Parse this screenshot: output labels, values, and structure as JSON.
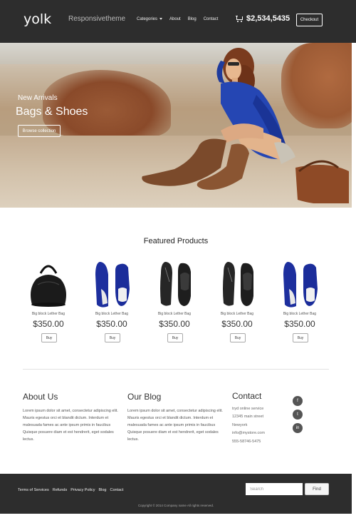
{
  "header": {
    "logo": "yolk",
    "tagline": "Responsivetheme",
    "nav": [
      "Categories",
      "About",
      "Blog",
      "Contact"
    ],
    "cart_total": "$2,534,5435",
    "checkout_label": "Checkout"
  },
  "hero": {
    "subtitle": "New Arrivals",
    "title": "Bags & Shoes",
    "button_label": "Browse collection"
  },
  "featured": {
    "title": "Featured Products",
    "products": [
      {
        "name": "Big block Lether Bag",
        "price": "$350.00",
        "buy": "Buy",
        "kind": "bag"
      },
      {
        "name": "Big block Lether Bag",
        "price": "$350.00",
        "buy": "Buy",
        "kind": "blue-shoes"
      },
      {
        "name": "Big block Lether Bag",
        "price": "$350.00",
        "buy": "Buy",
        "kind": "black-shoes"
      },
      {
        "name": "Big block Lether Bag",
        "price": "$350.00",
        "buy": "Buy",
        "kind": "black-shoes"
      },
      {
        "name": "Big block Lether Bag",
        "price": "$350.00",
        "buy": "Buy",
        "kind": "blue-shoes"
      }
    ]
  },
  "about": {
    "title": "About Us",
    "text": "Lorem ipsum dolor sit amet, consectetur adipiscing elit. Mauris egestus orci et blandit dictum. Interdum et malesuada fames ac ante ipsum primis in faucibus Quisque posuere diam et est hendrerit, eget sodales lectus."
  },
  "blog": {
    "title": "Our Blog",
    "text": "Lorem ipsum dolor sit amet, consectetur adipiscing elit. Mauris egestus orci et blandit dictum. Interdum et malesuada fames ac ante ipsum primis in faucibus Quisque posuere diam et est hendrerit, eget sodales lectus."
  },
  "contact": {
    "title": "Contact",
    "lines": [
      "tryd online service",
      "12345 main street",
      "Newyork",
      "info@mystore.com",
      "555-58746-5475"
    ],
    "social_icons": [
      "facebook-icon",
      "twitter-icon",
      "linkedin-icon"
    ],
    "social_glyphs": [
      "f",
      "t",
      "in"
    ]
  },
  "footer": {
    "links": [
      "Terms of Services",
      "Refunds",
      "Privacy Policy",
      "Blog",
      "Contact"
    ],
    "search_placeholder": "Search",
    "find_label": "Find",
    "copyright": "Copyright © 2014 Company name All rights reserved."
  }
}
